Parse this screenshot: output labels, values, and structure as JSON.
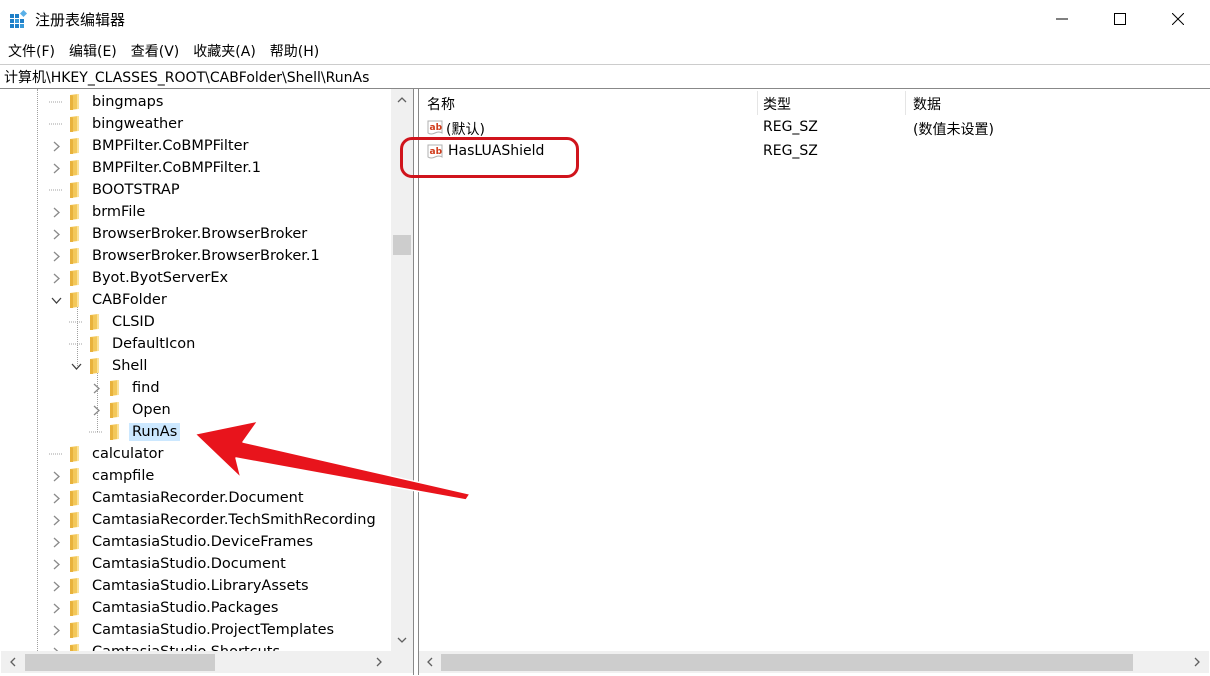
{
  "window": {
    "title": "注册表编辑器",
    "controls": {
      "minimize": "minimize",
      "maximize": "maximize",
      "close": "close"
    }
  },
  "menu": [
    "文件(F)",
    "编辑(E)",
    "查看(V)",
    "收藏夹(A)",
    "帮助(H)"
  ],
  "address": "计算机\\HKEY_CLASSES_ROOT\\CABFolder\\Shell\\RunAs",
  "tree": [
    {
      "label": "bingmaps",
      "level": 0,
      "expander": "none"
    },
    {
      "label": "bingweather",
      "level": 0,
      "expander": "none"
    },
    {
      "label": "BMPFilter.CoBMPFilter",
      "level": 0,
      "expander": "collapsed"
    },
    {
      "label": "BMPFilter.CoBMPFilter.1",
      "level": 0,
      "expander": "collapsed"
    },
    {
      "label": "BOOTSTRAP",
      "level": 0,
      "expander": "none"
    },
    {
      "label": "brmFile",
      "level": 0,
      "expander": "collapsed"
    },
    {
      "label": "BrowserBroker.BrowserBroker",
      "level": 0,
      "expander": "collapsed"
    },
    {
      "label": "BrowserBroker.BrowserBroker.1",
      "level": 0,
      "expander": "collapsed"
    },
    {
      "label": "Byot.ByotServerEx",
      "level": 0,
      "expander": "collapsed"
    },
    {
      "label": "CABFolder",
      "level": 0,
      "expander": "expanded"
    },
    {
      "label": "CLSID",
      "level": 1,
      "expander": "none"
    },
    {
      "label": "DefaultIcon",
      "level": 1,
      "expander": "none"
    },
    {
      "label": "Shell",
      "level": 1,
      "expander": "expanded"
    },
    {
      "label": "find",
      "level": 2,
      "expander": "collapsed"
    },
    {
      "label": "Open",
      "level": 2,
      "expander": "collapsed"
    },
    {
      "label": "RunAs",
      "level": 2,
      "expander": "none",
      "selected": true
    },
    {
      "label": "calculator",
      "level": 0,
      "expander": "none"
    },
    {
      "label": "campfile",
      "level": 0,
      "expander": "collapsed"
    },
    {
      "label": "CamtasiaRecorder.Document",
      "level": 0,
      "expander": "collapsed"
    },
    {
      "label": "CamtasiaRecorder.TechSmithRecording",
      "level": 0,
      "expander": "collapsed"
    },
    {
      "label": "CamtasiaStudio.DeviceFrames",
      "level": 0,
      "expander": "collapsed"
    },
    {
      "label": "CamtasiaStudio.Document",
      "level": 0,
      "expander": "collapsed"
    },
    {
      "label": "CamtasiaStudio.LibraryAssets",
      "level": 0,
      "expander": "collapsed"
    },
    {
      "label": "CamtasiaStudio.Packages",
      "level": 0,
      "expander": "collapsed"
    },
    {
      "label": "CamtasiaStudio.ProjectTemplates",
      "level": 0,
      "expander": "collapsed"
    },
    {
      "label": "CamtasiaStudio.Shortcuts",
      "level": 0,
      "expander": "collapsed"
    }
  ],
  "values": {
    "columns": [
      "名称",
      "类型",
      "数据"
    ],
    "rows": [
      {
        "name": "(默认)",
        "type": "REG_SZ",
        "data": "(数值未设置)",
        "icon": "string-value-icon"
      },
      {
        "name": "HasLUAShield",
        "type": "REG_SZ",
        "data": "",
        "icon": "string-value-icon",
        "highlighted": true
      }
    ]
  },
  "annotations": {
    "highlight_color": "#d0141c",
    "arrow_color": "#e8141c",
    "arrow_target": "RunAs",
    "box_target": "HasLUAShield"
  }
}
